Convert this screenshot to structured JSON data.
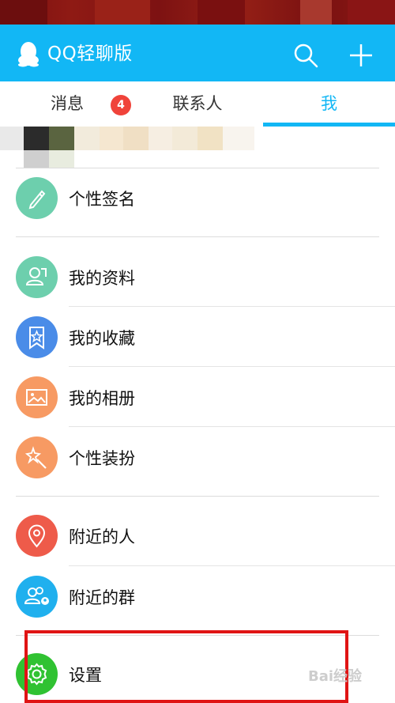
{
  "app": {
    "title": "QQ轻聊版",
    "icons": {
      "logo": "penguin-icon",
      "search": "search-icon",
      "add": "plus-icon"
    }
  },
  "tabs": [
    {
      "label": "消息",
      "badge": "4"
    },
    {
      "label": "联系人"
    },
    {
      "label": "我",
      "active": true
    }
  ],
  "colors": {
    "accent": "#12b7f5",
    "badge": "#f0433a",
    "highlight": "#e01414"
  },
  "menu": {
    "signature": {
      "label": "个性签名",
      "icon": "pen-icon",
      "color": "#6dcfad"
    },
    "profile": {
      "label": "我的资料",
      "icon": "profile-card-icon",
      "color": "#6dcfad"
    },
    "favorites": {
      "label": "我的收藏",
      "icon": "star-icon",
      "color": "#4a8ce8"
    },
    "album": {
      "label": "我的相册",
      "icon": "image-icon",
      "color": "#f79a63"
    },
    "dressup": {
      "label": "个性装扮",
      "icon": "magic-wand-icon",
      "color": "#f79a63"
    },
    "nearby_people": {
      "label": "附近的人",
      "icon": "location-pin-icon",
      "color": "#ee5b4a"
    },
    "nearby_groups": {
      "label": "附近的群",
      "icon": "group-location-icon",
      "color": "#20b0ee"
    },
    "settings": {
      "label": "设置",
      "icon": "gear-icon",
      "color": "#30c232"
    }
  },
  "watermark": {
    "text": "Bai经验"
  }
}
